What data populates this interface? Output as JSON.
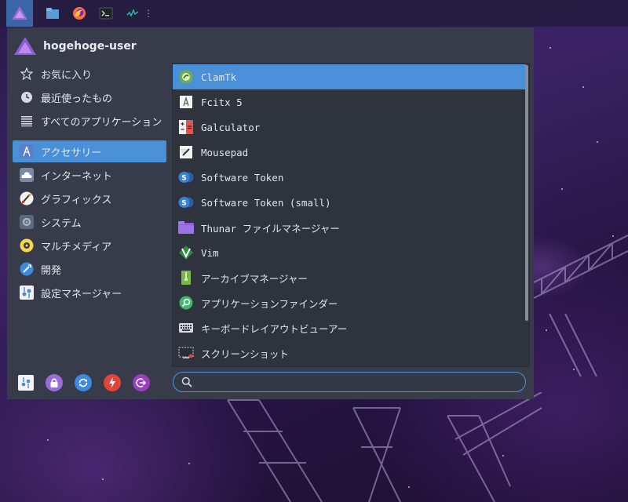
{
  "user": {
    "name": "hogehoge-user"
  },
  "categories": [
    {
      "label": "お気に入り",
      "icon": "star-icon"
    },
    {
      "label": "最近使ったもの",
      "icon": "clock-icon"
    },
    {
      "label": "すべてのアプリケーション",
      "icon": "list-icon"
    },
    {
      "label": "アクセサリー",
      "icon": "accessories-icon",
      "selected": true
    },
    {
      "label": "インターネット",
      "icon": "cloud-icon"
    },
    {
      "label": "グラフィックス",
      "icon": "graphics-icon"
    },
    {
      "label": "システム",
      "icon": "system-gear-icon"
    },
    {
      "label": "マルチメディア",
      "icon": "multimedia-icon"
    },
    {
      "label": "開発",
      "icon": "development-icon"
    },
    {
      "label": "設定マネージャー",
      "icon": "settings-manager-icon"
    }
  ],
  "apps": [
    {
      "label": "ClamTk",
      "icon": "clamtk-icon",
      "selected": true
    },
    {
      "label": "Fcitx 5",
      "icon": "fcitx-icon"
    },
    {
      "label": "Galculator",
      "icon": "calculator-icon"
    },
    {
      "label": "Mousepad",
      "icon": "text-editor-icon"
    },
    {
      "label": "Software Token",
      "icon": "software-token-icon"
    },
    {
      "label": "Software Token (small)",
      "icon": "software-token-small-icon"
    },
    {
      "label": "Thunar ファイルマネージャー",
      "icon": "folder-icon"
    },
    {
      "label": "Vim",
      "icon": "vim-icon"
    },
    {
      "label": "アーカイブマネージャー",
      "icon": "archive-icon"
    },
    {
      "label": "アプリケーションファインダー",
      "icon": "app-finder-icon"
    },
    {
      "label": "キーボードレイアウトビューアー",
      "icon": "keyboard-icon"
    },
    {
      "label": "スクリーンショット",
      "icon": "screenshot-icon"
    }
  ],
  "search": {
    "value": "",
    "placeholder": ""
  },
  "colors": {
    "accent": "#4a90d9",
    "menu_bg": "#383c4a",
    "list_bg": "#2f333e"
  }
}
